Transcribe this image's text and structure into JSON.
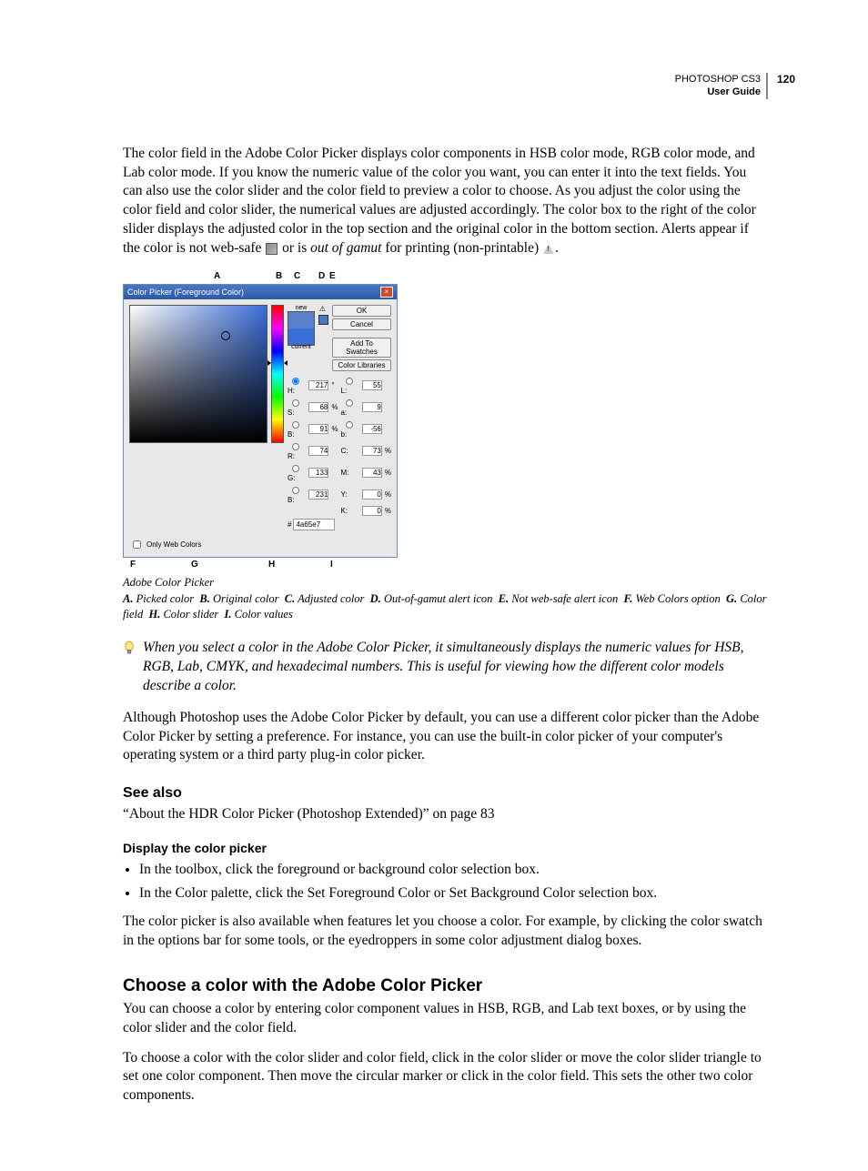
{
  "header": {
    "product": "PHOTOSHOP CS3",
    "doc": "User Guide",
    "page_num": "120"
  },
  "para1": "The color field in the Adobe Color Picker displays color components in HSB color mode, RGB color mode, and Lab color mode. If you know the numeric value of the color you want, you can enter it into the text fields. You can also use the color slider and the color field to preview a color to choose. As you adjust the color using the color field and color slider, the numerical values are adjusted accordingly. The color box to the right of the color slider displays the adjusted color in the top section and the original color in the bottom section. Alerts appear if the color is not web-safe ",
  "para1_mid": " or is ",
  "para1_gamut": "out of gamut",
  "para1_end": "  for printing (non-printable) ",
  "para1_period": ".",
  "fig": {
    "top_labels": {
      "A": "A",
      "B": "B",
      "C": "C",
      "D": "D",
      "E": "E"
    },
    "bot_labels": {
      "F": "F",
      "G": "G",
      "H": "H",
      "I": "I"
    },
    "title": "Color Picker (Foreground Color)",
    "new": "new",
    "current": "current",
    "btn_ok": "OK",
    "btn_cancel": "Cancel",
    "btn_add": "Add To Swatches",
    "btn_lib": "Color Libraries",
    "only_web": "Only Web Colors",
    "hex_prefix": "#",
    "hex": "4a65e7",
    "vals": {
      "H": "217",
      "H_u": "°",
      "S": "68",
      "S_u": "%",
      "Bv": "91",
      "B_u": "%",
      "R": "74",
      "G": "133",
      "Bl": "231",
      "L": "55",
      "a": "9",
      "b": "-56",
      "C": "73",
      "C_u": "%",
      "M": "43",
      "M_u": "%",
      "Y": "0",
      "Y_u": "%",
      "K": "0",
      "K_u": "%"
    }
  },
  "caption": "Adobe Color Picker",
  "legend": {
    "A": "Picked color",
    "B": "Original color",
    "C": "Adjusted color",
    "D": "Out-of-gamut alert icon",
    "E": "Not web-safe alert icon",
    "F": "Web Colors option",
    "G": "Color field",
    "H": "Color slider",
    "I": "Color values"
  },
  "tip": "When you select a color in the Adobe Color Picker, it simultaneously displays the numeric values for HSB, RGB, Lab, CMYK, and hexadecimal numbers. This is useful for viewing how the different color models describe a color.",
  "para2": "Although Photoshop uses the Adobe Color Picker by default, you can use a different color picker than the Adobe Color Picker by setting a preference. For instance, you can use the built-in color picker of your computer's operating system or a third party plug-in color picker.",
  "see_also_h": "See also",
  "see_also_link": "“About the HDR Color Picker (Photoshop Extended)” on page 83",
  "display_h": "Display the color picker",
  "bullets": [
    "In the toolbox, click the foreground or background color selection box.",
    "In the Color palette, click the Set Foreground Color or Set Background Color selection box."
  ],
  "para3": "The color picker is also available when features let you choose a color. For example, by clicking the color swatch in the options bar for some tools, or the eyedroppers in some color adjustment dialog boxes.",
  "choose_h": "Choose a color with the Adobe Color Picker",
  "para4": "You can choose a color by entering color component values in HSB, RGB, and Lab text boxes, or by using the color slider and the color field.",
  "para5": "To choose a color with the color slider and color field, click in the color slider or move the color slider triangle to set one color component. Then move the circular marker or click in the color field. This sets the other two color components."
}
